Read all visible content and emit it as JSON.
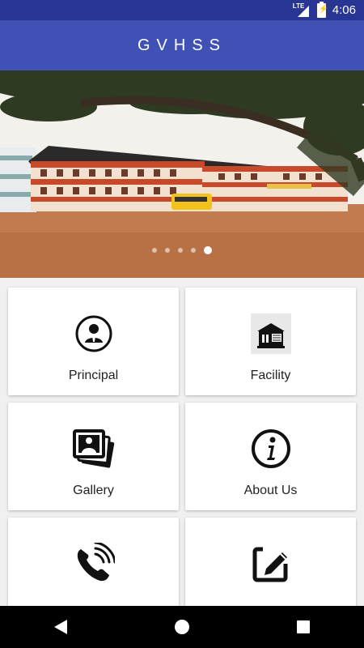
{
  "status_bar": {
    "network": "LTE",
    "time": "4:06"
  },
  "app_bar": {
    "title": "GVHSS"
  },
  "banner": {
    "slide_count": 5,
    "active_slide": 5
  },
  "menu": [
    {
      "label": "Principal",
      "icon": "principal-person-icon"
    },
    {
      "label": "Facility",
      "icon": "school-building-icon"
    },
    {
      "label": "Gallery",
      "icon": "photo-gallery-icon"
    },
    {
      "label": "About Us",
      "icon": "info-icon"
    },
    {
      "label": "",
      "icon": "phone-call-icon"
    },
    {
      "label": "",
      "icon": "edit-note-icon"
    }
  ],
  "colors": {
    "primary": "#3f51b5",
    "primary_dark": "#283593"
  }
}
